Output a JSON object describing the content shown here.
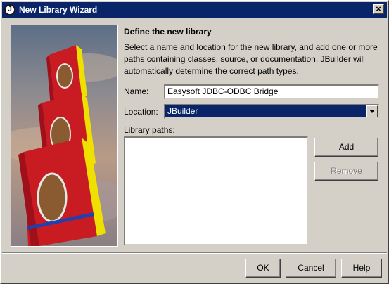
{
  "window": {
    "title": "New Library Wizard",
    "icon": "jbuilder-icon",
    "close_label": "×"
  },
  "page": {
    "heading": "Define the new library",
    "description": "Select a name and location for the new library, and add one or more paths containing classes, source, or documentation. JBuilder will automatically determine the correct path types."
  },
  "form": {
    "name_label": "Name:",
    "name_value": "Easysoft JDBC-ODBC Bridge",
    "location_label": "Location:",
    "location_value": "JBuilder",
    "paths_label": "Library paths:",
    "paths": []
  },
  "buttons": {
    "add": "Add",
    "remove": "Remove",
    "ok": "OK",
    "cancel": "Cancel",
    "help": "Help"
  },
  "colors": {
    "title_bar": "#0a246a",
    "dialog_bg": "#d4d0c8",
    "selection": "#0a246a"
  }
}
